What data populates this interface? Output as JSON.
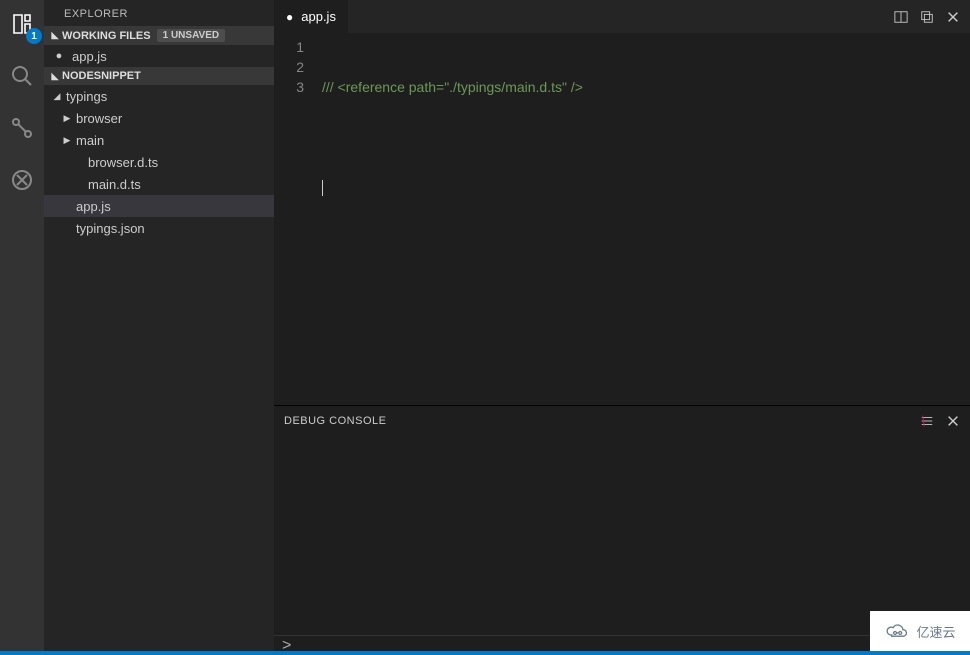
{
  "activitybar": {
    "explorer_badge": "1"
  },
  "sidebar": {
    "title": "EXPLORER",
    "working_files": {
      "header": "WORKING FILES",
      "unsaved_label": "1 UNSAVED",
      "items": [
        "app.js"
      ]
    },
    "project": {
      "header": "NODESNIPPET",
      "tree": {
        "typings": {
          "label": "typings",
          "browser": "browser",
          "main": "main",
          "browser_d_ts": "browser.d.ts",
          "main_d_ts": "main.d.ts"
        },
        "app_js": "app.js",
        "typings_json": "typings.json"
      }
    }
  },
  "editor": {
    "tab": {
      "name": "app.js"
    },
    "lines": {
      "n1": "1",
      "n2": "2",
      "n3": "3"
    },
    "code": {
      "l1": "/// <reference path=\"./typings/main.d.ts\" />",
      "l2": "",
      "l3": ""
    }
  },
  "panel": {
    "title": "DEBUG CONSOLE",
    "repl_prompt": ">"
  },
  "watermark": {
    "text": "亿速云"
  }
}
